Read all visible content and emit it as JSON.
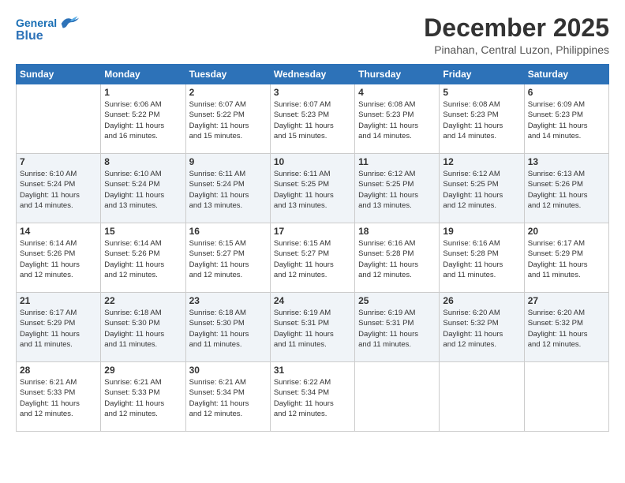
{
  "header": {
    "logo_line1": "General",
    "logo_line2": "Blue",
    "month": "December 2025",
    "location": "Pinahan, Central Luzon, Philippines"
  },
  "days_of_week": [
    "Sunday",
    "Monday",
    "Tuesday",
    "Wednesday",
    "Thursday",
    "Friday",
    "Saturday"
  ],
  "weeks": [
    [
      {
        "day": "",
        "info": ""
      },
      {
        "day": "1",
        "info": "Sunrise: 6:06 AM\nSunset: 5:22 PM\nDaylight: 11 hours\nand 16 minutes."
      },
      {
        "day": "2",
        "info": "Sunrise: 6:07 AM\nSunset: 5:22 PM\nDaylight: 11 hours\nand 15 minutes."
      },
      {
        "day": "3",
        "info": "Sunrise: 6:07 AM\nSunset: 5:23 PM\nDaylight: 11 hours\nand 15 minutes."
      },
      {
        "day": "4",
        "info": "Sunrise: 6:08 AM\nSunset: 5:23 PM\nDaylight: 11 hours\nand 14 minutes."
      },
      {
        "day": "5",
        "info": "Sunrise: 6:08 AM\nSunset: 5:23 PM\nDaylight: 11 hours\nand 14 minutes."
      },
      {
        "day": "6",
        "info": "Sunrise: 6:09 AM\nSunset: 5:23 PM\nDaylight: 11 hours\nand 14 minutes."
      }
    ],
    [
      {
        "day": "7",
        "info": "Sunrise: 6:10 AM\nSunset: 5:24 PM\nDaylight: 11 hours\nand 14 minutes."
      },
      {
        "day": "8",
        "info": "Sunrise: 6:10 AM\nSunset: 5:24 PM\nDaylight: 11 hours\nand 13 minutes."
      },
      {
        "day": "9",
        "info": "Sunrise: 6:11 AM\nSunset: 5:24 PM\nDaylight: 11 hours\nand 13 minutes."
      },
      {
        "day": "10",
        "info": "Sunrise: 6:11 AM\nSunset: 5:25 PM\nDaylight: 11 hours\nand 13 minutes."
      },
      {
        "day": "11",
        "info": "Sunrise: 6:12 AM\nSunset: 5:25 PM\nDaylight: 11 hours\nand 13 minutes."
      },
      {
        "day": "12",
        "info": "Sunrise: 6:12 AM\nSunset: 5:25 PM\nDaylight: 11 hours\nand 12 minutes."
      },
      {
        "day": "13",
        "info": "Sunrise: 6:13 AM\nSunset: 5:26 PM\nDaylight: 11 hours\nand 12 minutes."
      }
    ],
    [
      {
        "day": "14",
        "info": "Sunrise: 6:14 AM\nSunset: 5:26 PM\nDaylight: 11 hours\nand 12 minutes."
      },
      {
        "day": "15",
        "info": "Sunrise: 6:14 AM\nSunset: 5:26 PM\nDaylight: 11 hours\nand 12 minutes."
      },
      {
        "day": "16",
        "info": "Sunrise: 6:15 AM\nSunset: 5:27 PM\nDaylight: 11 hours\nand 12 minutes."
      },
      {
        "day": "17",
        "info": "Sunrise: 6:15 AM\nSunset: 5:27 PM\nDaylight: 11 hours\nand 12 minutes."
      },
      {
        "day": "18",
        "info": "Sunrise: 6:16 AM\nSunset: 5:28 PM\nDaylight: 11 hours\nand 12 minutes."
      },
      {
        "day": "19",
        "info": "Sunrise: 6:16 AM\nSunset: 5:28 PM\nDaylight: 11 hours\nand 11 minutes."
      },
      {
        "day": "20",
        "info": "Sunrise: 6:17 AM\nSunset: 5:29 PM\nDaylight: 11 hours\nand 11 minutes."
      }
    ],
    [
      {
        "day": "21",
        "info": "Sunrise: 6:17 AM\nSunset: 5:29 PM\nDaylight: 11 hours\nand 11 minutes."
      },
      {
        "day": "22",
        "info": "Sunrise: 6:18 AM\nSunset: 5:30 PM\nDaylight: 11 hours\nand 11 minutes."
      },
      {
        "day": "23",
        "info": "Sunrise: 6:18 AM\nSunset: 5:30 PM\nDaylight: 11 hours\nand 11 minutes."
      },
      {
        "day": "24",
        "info": "Sunrise: 6:19 AM\nSunset: 5:31 PM\nDaylight: 11 hours\nand 11 minutes."
      },
      {
        "day": "25",
        "info": "Sunrise: 6:19 AM\nSunset: 5:31 PM\nDaylight: 11 hours\nand 11 minutes."
      },
      {
        "day": "26",
        "info": "Sunrise: 6:20 AM\nSunset: 5:32 PM\nDaylight: 11 hours\nand 12 minutes."
      },
      {
        "day": "27",
        "info": "Sunrise: 6:20 AM\nSunset: 5:32 PM\nDaylight: 11 hours\nand 12 minutes."
      }
    ],
    [
      {
        "day": "28",
        "info": "Sunrise: 6:21 AM\nSunset: 5:33 PM\nDaylight: 11 hours\nand 12 minutes."
      },
      {
        "day": "29",
        "info": "Sunrise: 6:21 AM\nSunset: 5:33 PM\nDaylight: 11 hours\nand 12 minutes."
      },
      {
        "day": "30",
        "info": "Sunrise: 6:21 AM\nSunset: 5:34 PM\nDaylight: 11 hours\nand 12 minutes."
      },
      {
        "day": "31",
        "info": "Sunrise: 6:22 AM\nSunset: 5:34 PM\nDaylight: 11 hours\nand 12 minutes."
      },
      {
        "day": "",
        "info": ""
      },
      {
        "day": "",
        "info": ""
      },
      {
        "day": "",
        "info": ""
      }
    ]
  ]
}
